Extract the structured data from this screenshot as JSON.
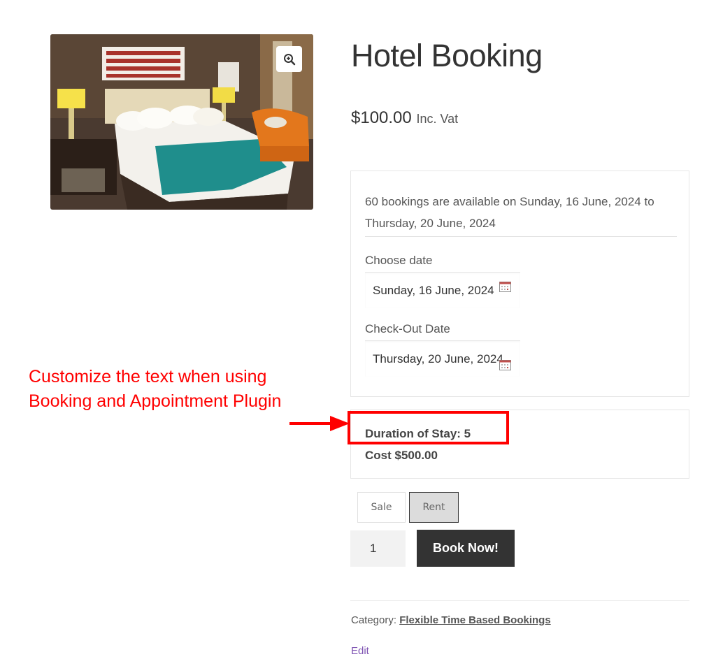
{
  "product": {
    "title": "Hotel Booking",
    "price": "$100.00",
    "price_suffix": "Inc. Vat",
    "image_alt": "hotel-room-photo"
  },
  "booking": {
    "availability": "60 bookings are available on Sunday, 16 June, 2024 to Thursday, 20 June, 2024",
    "choose_date_label": "Choose date",
    "choose_date_value": "Sunday, 16 June, 2024",
    "checkout_label": "Check-Out Date",
    "checkout_value": "Thursday, 20 June, 2024"
  },
  "summary": {
    "duration": "Duration of Stay: 5",
    "cost": "Cost $500.00"
  },
  "options": {
    "sale_label": "Sale",
    "rent_label": "Rent",
    "selected": "Rent"
  },
  "cart": {
    "quantity": "1",
    "book_label": "Book Now!"
  },
  "meta": {
    "category_label": "Category:",
    "category_value": "Flexible Time Based Bookings",
    "edit_label": "Edit"
  },
  "annotation": {
    "text_line1": "Customize the text when using",
    "text_line2": "Booking and Appointment Plugin",
    "color": "#ff0000"
  },
  "icons": [
    "zoom-icon",
    "calendar-icon"
  ],
  "colors": {
    "accent_purple": "#7f54b3",
    "button_dark": "#333333",
    "annotation_red": "#ff0000"
  }
}
